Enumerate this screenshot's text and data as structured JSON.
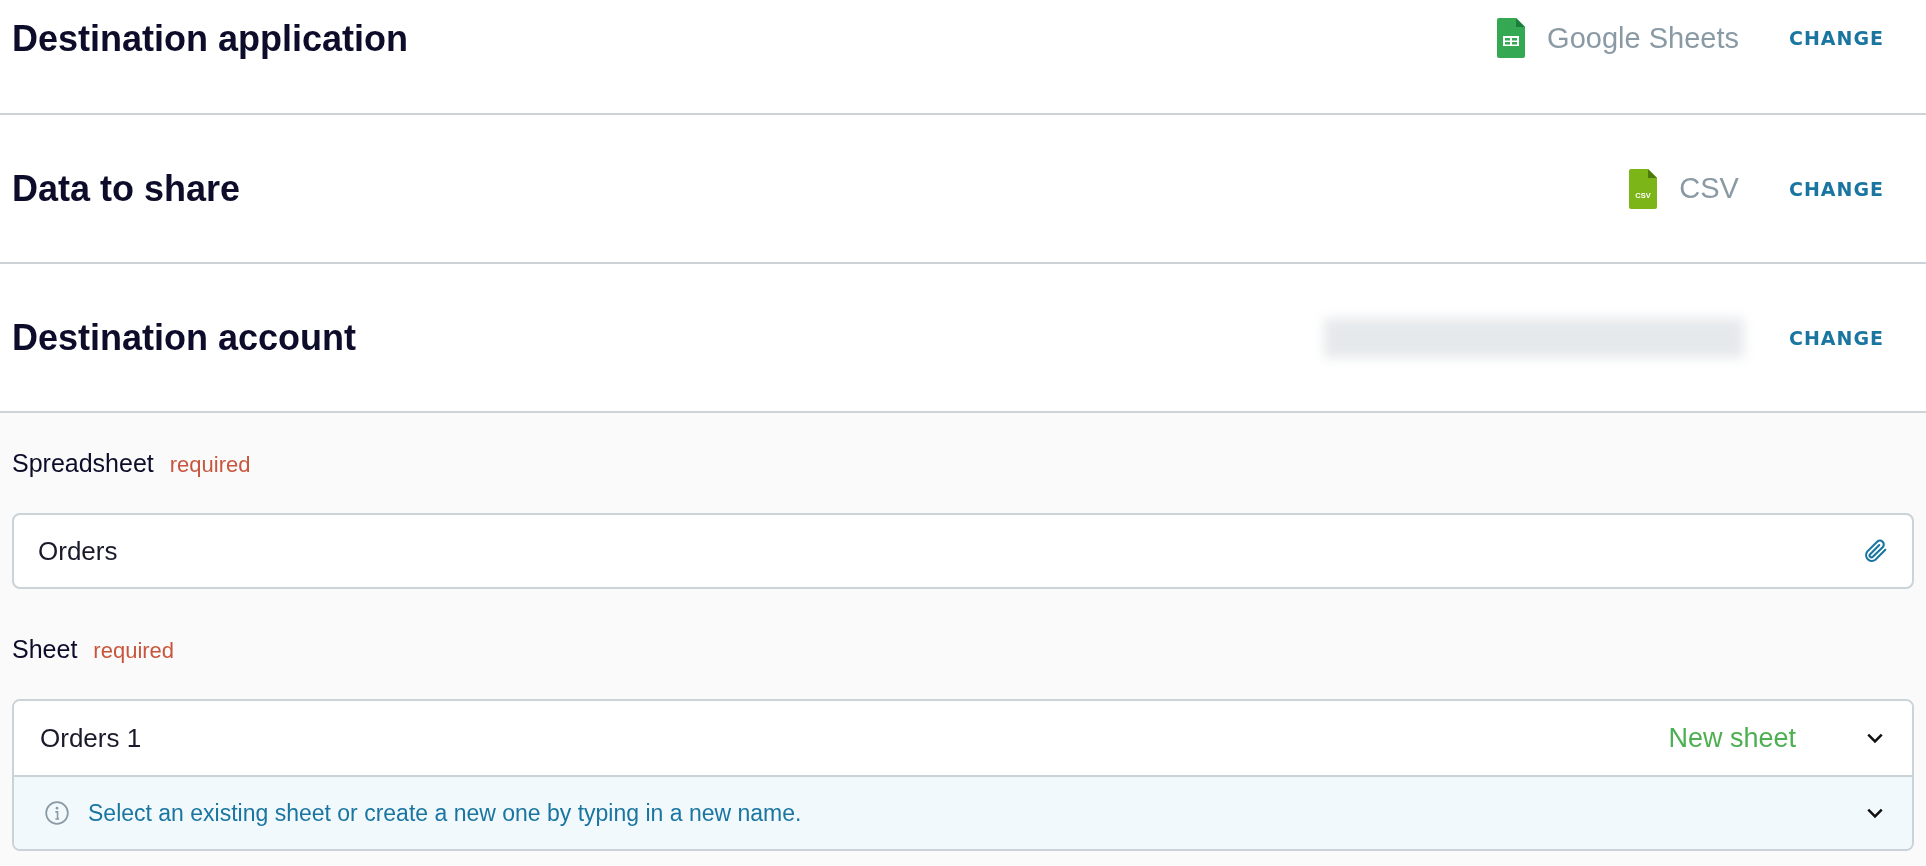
{
  "sections": [
    {
      "title": "Destination application",
      "kind": "sheets",
      "value": "Google Sheets",
      "action": "CHANGE"
    },
    {
      "title": "Data to share",
      "kind": "csv",
      "icon_label": "CSV",
      "value": "CSV",
      "action": "CHANGE"
    },
    {
      "title": "Destination account",
      "kind": "redacted",
      "action": "CHANGE"
    }
  ],
  "spreadsheet": {
    "label": "Spreadsheet",
    "required": "required",
    "value": "Orders"
  },
  "sheet": {
    "label": "Sheet",
    "required": "required",
    "value": "Orders 1",
    "badge": "New sheet",
    "hint": "Select an existing sheet or create a new one by typing in a new name.",
    "expanded": false
  }
}
